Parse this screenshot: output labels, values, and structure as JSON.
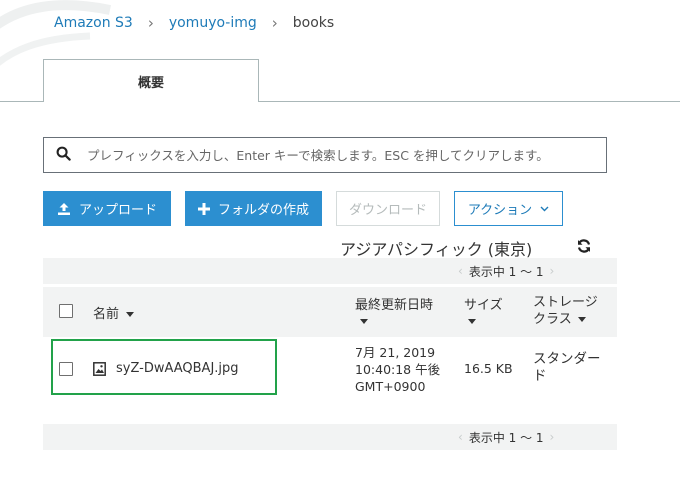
{
  "breadcrumb": {
    "root": "Amazon S3",
    "bucket": "yomuyo-img",
    "folder": "books",
    "separator": "›"
  },
  "tabs": [
    {
      "label": "概要",
      "active": true
    }
  ],
  "search": {
    "placeholder": "プレフィックスを入力し、Enter キーで検索します。ESC を押してクリアします。",
    "value": ""
  },
  "toolbar": {
    "upload_label": "アップロード",
    "create_folder_label": "フォルダの作成",
    "download_label": "ダウンロード",
    "actions_label": "アクション"
  },
  "region": "アジアパシフィック (東京)",
  "pager": {
    "text": "表示中 1 ～ 1"
  },
  "table": {
    "columns": {
      "name": "名前",
      "last_modified": "最終更新日時",
      "size": "サイズ",
      "storage_class_line1": "ストレージ",
      "storage_class_line2": "クラス"
    },
    "rows": [
      {
        "name": "syZ-DwAAQBAJ.jpg",
        "last_modified_line1": "7月 21, 2019",
        "last_modified_line2": "10:40:18 午後",
        "last_modified_line3": "GMT+0900",
        "size": "16.5 KB",
        "storage_class_line1": "スタンダー",
        "storage_class_line2": "ド"
      }
    ]
  },
  "colors": {
    "primary": "#2c8fd0",
    "link": "#1e7bb8",
    "highlight": "#22a24a",
    "header_bg": "#f2f3f3"
  },
  "icons": [
    "search-icon",
    "upload-icon",
    "plus-icon",
    "chevron-down-icon",
    "refresh-icon",
    "image-file-icon"
  ]
}
